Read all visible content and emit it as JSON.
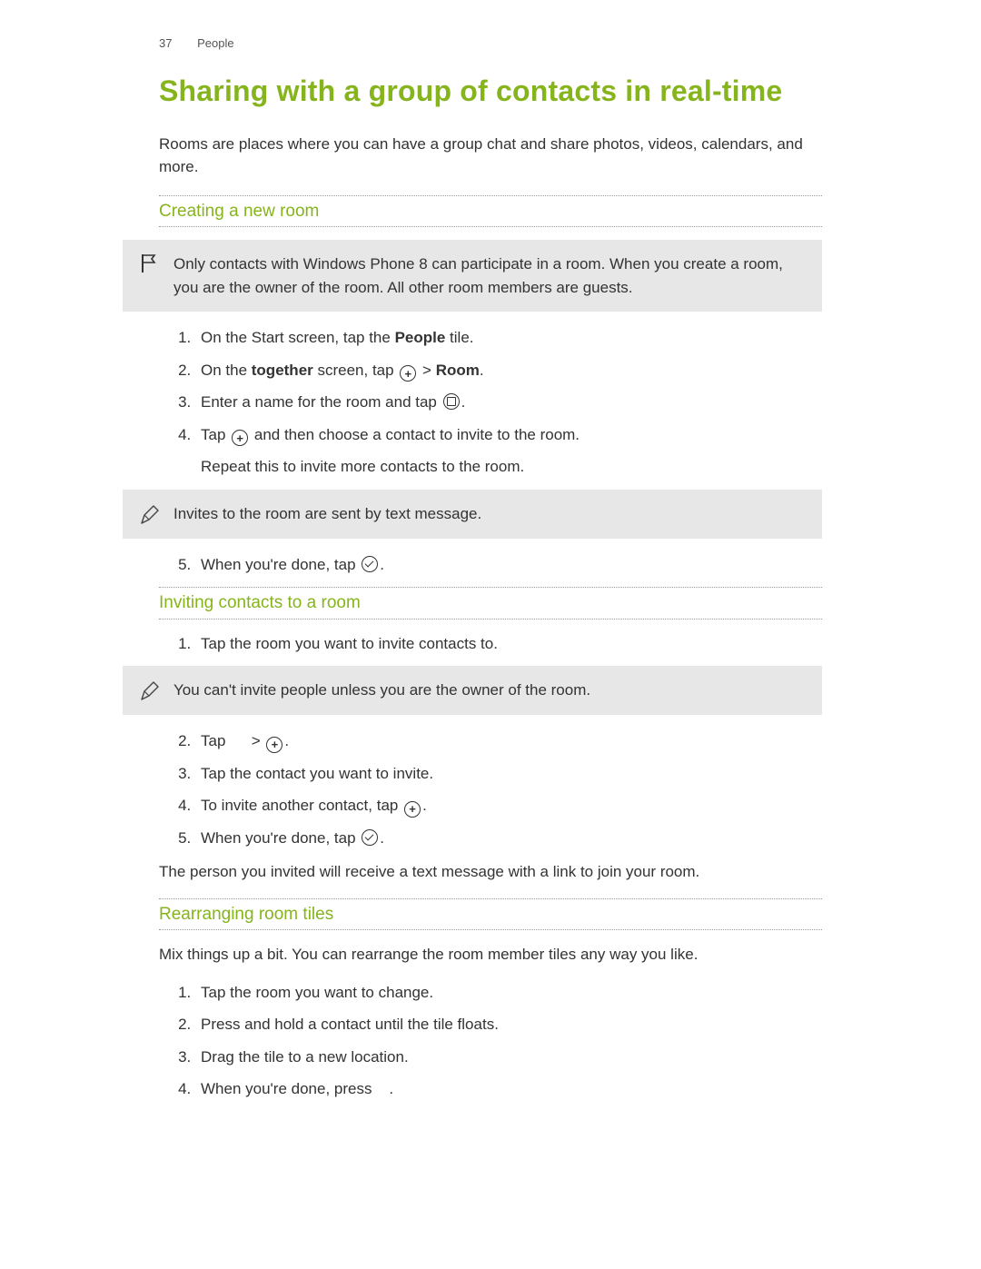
{
  "header": {
    "page_number": "37",
    "section": "People"
  },
  "title": "Sharing with a group of contacts in real-time",
  "intro": "Rooms are places where you can have a group chat and share photos, videos, calendars, and more.",
  "sec1": {
    "heading": "Creating a new room",
    "note": "Only contacts with Windows Phone 8 can participate in a room. When you create a room, you are the owner of the room. All other room members are guests.",
    "s1a": "On the Start screen, tap the ",
    "s1b": "People",
    "s1c": " tile.",
    "s2a": "On the ",
    "s2b": "together",
    "s2c": " screen, tap ",
    "s2d": " > ",
    "s2e": "Room",
    "s2f": ".",
    "s3a": "Enter a name for the room and tap ",
    "s3b": ".",
    "s4a": "Tap ",
    "s4b": " and then choose a contact to invite to the room.",
    "s4sub": "Repeat this to invite more contacts to the room.",
    "tip": "Invites to the room are sent by text message.",
    "s5a": "When you're done, tap ",
    "s5b": "."
  },
  "sec2": {
    "heading": "Inviting contacts to a room",
    "s1": "Tap the room you want to invite contacts to.",
    "tip": "You can't invite people unless you are the owner of the room.",
    "s2a": "Tap ",
    "s2b": " > ",
    "s2c": ".",
    "s3": "Tap the contact you want to invite.",
    "s4a": "To invite another contact, tap ",
    "s4b": ".",
    "s5a": "When you're done, tap ",
    "s5b": ".",
    "outro": "The person you invited will receive a text message with a link to join your room."
  },
  "sec3": {
    "heading": "Rearranging room tiles",
    "intro": "Mix things up a bit. You can rearrange the room member tiles any way you like.",
    "s1": "Tap the room you want to change.",
    "s2": "Press and hold a contact until the tile floats.",
    "s3": "Drag the tile to a new location.",
    "s4a": "When you're done, press ",
    "s4b": "."
  }
}
